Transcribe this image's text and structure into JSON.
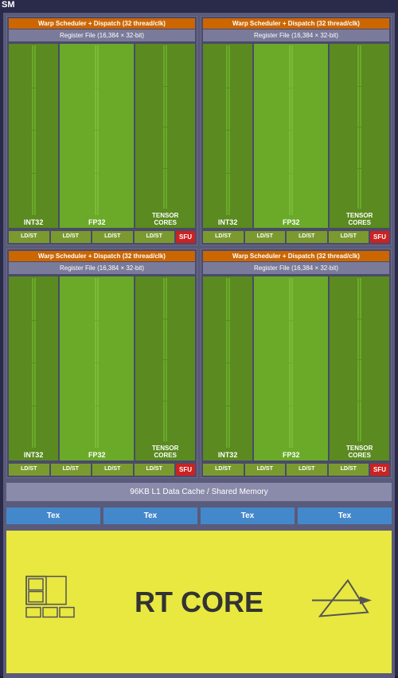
{
  "sm": {
    "label": "SM",
    "quadrants": [
      {
        "warp_scheduler": "Warp Scheduler + Dispatch (32 thread/clk)",
        "register_file": "Register File (16,384 × 32-bit)",
        "int32_label": "INT32",
        "fp32_label": "FP32",
        "tensor_label": "TENSOR\nCORES",
        "ld_st_labels": [
          "LD/ST",
          "LD/ST",
          "LD/ST",
          "LD/ST"
        ],
        "sfu_label": "SFU"
      },
      {
        "warp_scheduler": "Warp Scheduler + Dispatch (32 thread/clk)",
        "register_file": "Register File (16,384 × 32-bit)",
        "int32_label": "INT32",
        "fp32_label": "FP32",
        "tensor_label": "TENSOR\nCORES",
        "ld_st_labels": [
          "LD/ST",
          "LD/ST",
          "LD/ST",
          "LD/ST"
        ],
        "sfu_label": "SFU"
      },
      {
        "warp_scheduler": "Warp Scheduler + Dispatch (32 thread/clk)",
        "register_file": "Register File (16,384 × 32-bit)",
        "int32_label": "INT32",
        "fp32_label": "FP32",
        "tensor_label": "TENSOR\nCORES",
        "ld_st_labels": [
          "LD/ST",
          "LD/ST",
          "LD/ST",
          "LD/ST"
        ],
        "sfu_label": "SFU"
      },
      {
        "warp_scheduler": "Warp Scheduler + Dispatch (32 thread/clk)",
        "register_file": "Register File (16,384 × 32-bit)",
        "int32_label": "INT32",
        "fp32_label": "FP32",
        "tensor_label": "TENSOR\nCORES",
        "ld_st_labels": [
          "LD/ST",
          "LD/ST",
          "LD/ST",
          "LD/ST"
        ],
        "sfu_label": "SFU"
      }
    ],
    "l1_cache": "96KB L1 Data Cache / Shared Memory",
    "tex_units": [
      "Tex",
      "Tex",
      "Tex",
      "Tex"
    ],
    "rt_core": "RT CORE"
  }
}
